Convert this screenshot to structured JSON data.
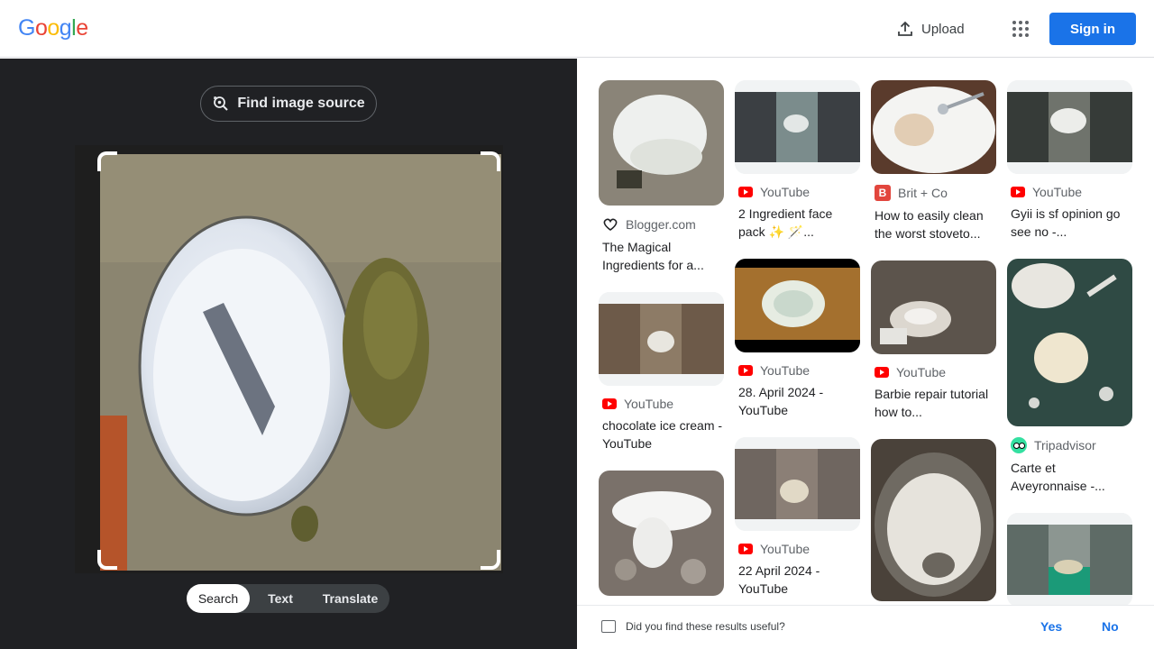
{
  "header": {
    "logo": [
      "G",
      "o",
      "o",
      "g",
      "l",
      "e"
    ],
    "logo_colors": [
      "#4285f4",
      "#ea4335",
      "#fbbc05",
      "#4285f4",
      "#34a853",
      "#ea4335"
    ],
    "upload_label": "Upload",
    "signin_label": "Sign in"
  },
  "left": {
    "find_source_label": "Find image source",
    "tabs": [
      {
        "label": "Search",
        "active": true
      },
      {
        "label": "Text",
        "active": false
      },
      {
        "label": "Translate",
        "active": false
      }
    ]
  },
  "results": [
    [
      {
        "source": "Blogger.com",
        "icon": "heart-icon",
        "title": "The Magical Ingredients for a..."
      },
      {
        "source": "YouTube",
        "icon": "youtube-icon",
        "title": "chocolate ice cream - YouTube"
      },
      {
        "source": "",
        "icon": "",
        "title": ""
      }
    ],
    [
      {
        "source": "YouTube",
        "icon": "youtube-icon",
        "title": "2 Ingredient face pack ✨ 🪄..."
      },
      {
        "source": "YouTube",
        "icon": "youtube-icon",
        "title": "28. April 2024 - YouTube"
      },
      {
        "source": "YouTube",
        "icon": "youtube-icon",
        "title": "22 April 2024 - YouTube"
      }
    ],
    [
      {
        "source": "Brit + Co",
        "icon": "britco-icon",
        "title": "How to easily clean the worst stoveto..."
      },
      {
        "source": "YouTube",
        "icon": "youtube-icon",
        "title": "Barbie repair tutorial how to..."
      },
      {
        "source": "",
        "icon": "",
        "title": ""
      }
    ],
    [
      {
        "source": "YouTube",
        "icon": "youtube-icon",
        "title": "Gyii is sf opinion go see no -..."
      },
      {
        "source": "Tripadvisor",
        "icon": "tripadvisor-icon",
        "title": "Carte et Aveyronnaise -..."
      },
      {
        "source": "",
        "icon": "",
        "title": ""
      }
    ]
  ],
  "feedback": {
    "question": "Did you find these results useful?",
    "yes": "Yes",
    "no": "No"
  },
  "colors": {
    "accent": "#1a73e8",
    "dark_panel": "#202124",
    "youtube_red": "#ff0000"
  }
}
